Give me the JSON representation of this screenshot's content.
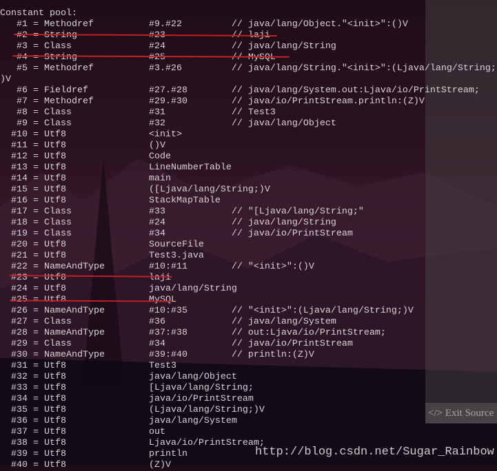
{
  "terminal": {
    "lines": [
      "",
      "Constant pool:",
      "   #1 = Methodref          #9.#22         // java/lang/Object.\"<init>\":()V",
      "   #2 = String             #23            // laji",
      "   #3 = Class              #24            // java/lang/String",
      "   #4 = String             #25            // MySQL",
      "   #5 = Methodref          #3.#26         // java/lang/String.\"<init>\":(Ljava/lang/String;",
      ")V",
      "   #6 = Fieldref           #27.#28        // java/lang/System.out:Ljava/io/PrintStream;",
      "   #7 = Methodref          #29.#30        // java/io/PrintStream.println:(Z)V",
      "   #8 = Class              #31            // Test3",
      "   #9 = Class              #32            // java/lang/Object",
      "  #10 = Utf8               <init>",
      "  #11 = Utf8               ()V",
      "  #12 = Utf8               Code",
      "  #13 = Utf8               LineNumberTable",
      "  #14 = Utf8               main",
      "  #15 = Utf8               ([Ljava/lang/String;)V",
      "  #16 = Utf8               StackMapTable",
      "  #17 = Class              #33            // \"[Ljava/lang/String;\"",
      "  #18 = Class              #24            // java/lang/String",
      "  #19 = Class              #34            // java/io/PrintStream",
      "  #20 = Utf8               SourceFile",
      "  #21 = Utf8               Test3.java",
      "  #22 = NameAndType        #10:#11        // \"<init>\":()V",
      "  #23 = Utf8               laji",
      "  #24 = Utf8               java/lang/String",
      "  #25 = Utf8               MySQL",
      "  #26 = NameAndType        #10:#35        // \"<init>\":(Ljava/lang/String;)V",
      "  #27 = Class              #36            // java/lang/System",
      "  #28 = NameAndType        #37:#38        // out:Ljava/io/PrintStream;",
      "  #29 = Class              #34            // java/io/PrintStream",
      "  #30 = NameAndType        #39:#40        // println:(Z)V",
      "  #31 = Utf8               Test3",
      "  #32 = Utf8               java/lang/Object",
      "  #33 = Utf8               [Ljava/lang/String;",
      "  #34 = Utf8               java/io/PrintStream",
      "  #35 = Utf8               (Ljava/lang/String;)V",
      "  #36 = Utf8               java/lang/System",
      "  #37 = Utf8               out",
      "  #38 = Utf8               Ljava/io/PrintStream;",
      "  #39 = Utf8               println",
      "  #40 = Utf8               (Z)V"
    ]
  },
  "exit_source_label": "</> Exit Source",
  "watermark": "http://blog.csdn.net/Sugar_Rainbow",
  "colors": {
    "underline": "#c0202a",
    "text": "#d8d4d6"
  }
}
